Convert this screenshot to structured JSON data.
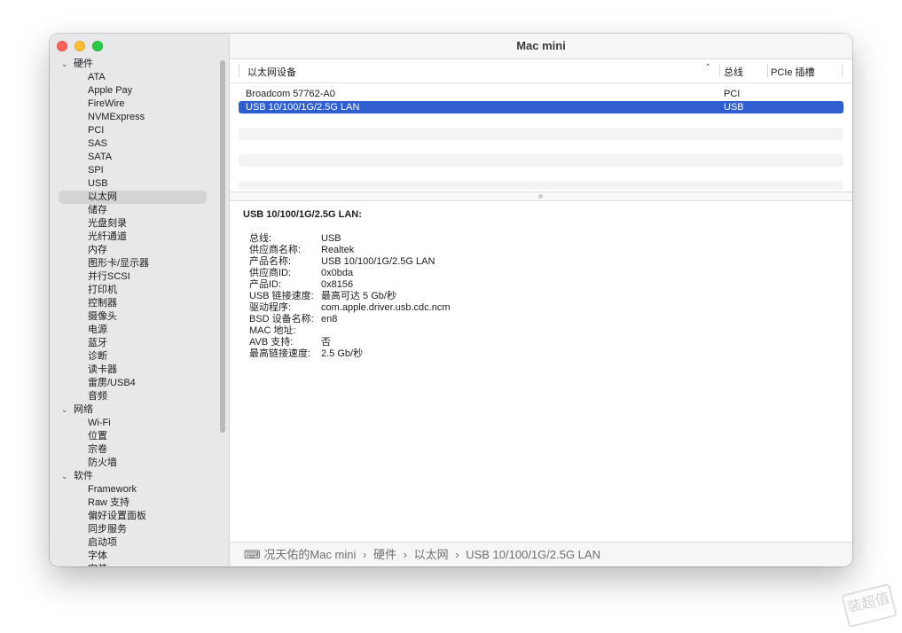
{
  "window": {
    "title": "Mac mini"
  },
  "sidebar": {
    "rows": [
      {
        "label": "硬件",
        "kind": "cat"
      },
      {
        "label": "ATA",
        "kind": "item"
      },
      {
        "label": "Apple Pay",
        "kind": "item"
      },
      {
        "label": "FireWire",
        "kind": "item"
      },
      {
        "label": "NVMExpress",
        "kind": "item"
      },
      {
        "label": "PCI",
        "kind": "item"
      },
      {
        "label": "SAS",
        "kind": "item"
      },
      {
        "label": "SATA",
        "kind": "item"
      },
      {
        "label": "SPI",
        "kind": "item"
      },
      {
        "label": "USB",
        "kind": "item"
      },
      {
        "label": "以太网",
        "kind": "item",
        "selected": true
      },
      {
        "label": "储存",
        "kind": "item"
      },
      {
        "label": "光盘刻录",
        "kind": "item"
      },
      {
        "label": "光纤通道",
        "kind": "item"
      },
      {
        "label": "内存",
        "kind": "item"
      },
      {
        "label": "图形卡/显示器",
        "kind": "item"
      },
      {
        "label": "并行SCSI",
        "kind": "item"
      },
      {
        "label": "打印机",
        "kind": "item"
      },
      {
        "label": "控制器",
        "kind": "item"
      },
      {
        "label": "摄像头",
        "kind": "item"
      },
      {
        "label": "电源",
        "kind": "item"
      },
      {
        "label": "蓝牙",
        "kind": "item"
      },
      {
        "label": "诊断",
        "kind": "item"
      },
      {
        "label": "读卡器",
        "kind": "item"
      },
      {
        "label": "雷雳/USB4",
        "kind": "item"
      },
      {
        "label": "音频",
        "kind": "item"
      },
      {
        "label": "网络",
        "kind": "cat"
      },
      {
        "label": "Wi-Fi",
        "kind": "item"
      },
      {
        "label": "位置",
        "kind": "item"
      },
      {
        "label": "宗卷",
        "kind": "item"
      },
      {
        "label": "防火墙",
        "kind": "item"
      },
      {
        "label": "软件",
        "kind": "cat"
      },
      {
        "label": "Framework",
        "kind": "item"
      },
      {
        "label": "Raw 支持",
        "kind": "item"
      },
      {
        "label": "偏好设置面板",
        "kind": "item"
      },
      {
        "label": "同步服务",
        "kind": "item"
      },
      {
        "label": "启动项",
        "kind": "item"
      },
      {
        "label": "字体",
        "kind": "item"
      },
      {
        "label": "安装",
        "kind": "item"
      }
    ]
  },
  "table": {
    "columns": [
      "以太网设备",
      "总线",
      "PCIe 插槽"
    ],
    "rows": [
      {
        "device": "Broadcom 57762-A0",
        "bus": "PCI",
        "slot": ""
      },
      {
        "device": "USB 10/100/1G/2.5G LAN",
        "bus": "USB",
        "slot": "",
        "selected": true
      }
    ]
  },
  "detail": {
    "title": "USB 10/100/1G/2.5G LAN:",
    "fields": [
      {
        "k": "总线:",
        "v": "USB"
      },
      {
        "k": "供应商名称:",
        "v": "Realtek"
      },
      {
        "k": "产品名称:",
        "v": "USB 10/100/1G/2.5G LAN"
      },
      {
        "k": "供应商ID:",
        "v": "0x0bda"
      },
      {
        "k": "产品ID:",
        "v": "0x8156"
      },
      {
        "k": "USB 链接速度:",
        "v": "最高可达 5 Gb/秒"
      },
      {
        "k": "驱动程序:",
        "v": "com.apple.driver.usb.cdc.ncm"
      },
      {
        "k": "BSD 设备名称:",
        "v": "en8"
      },
      {
        "k": "MAC 地址:",
        "v": ""
      },
      {
        "k": "AVB 支持:",
        "v": "否"
      },
      {
        "k": "最高链接速度:",
        "v": "2.5 Gb/秒"
      }
    ]
  },
  "pathbar": {
    "crumbs": [
      "况天佑的Mac mini",
      "硬件",
      "以太网",
      "USB 10/100/1G/2.5G LAN"
    ],
    "separator": "›"
  },
  "watermark": {
    "text": "装超值"
  },
  "colors": {
    "selection": "#2f5ed1",
    "sidebar_bg": "#e8e8ea"
  }
}
